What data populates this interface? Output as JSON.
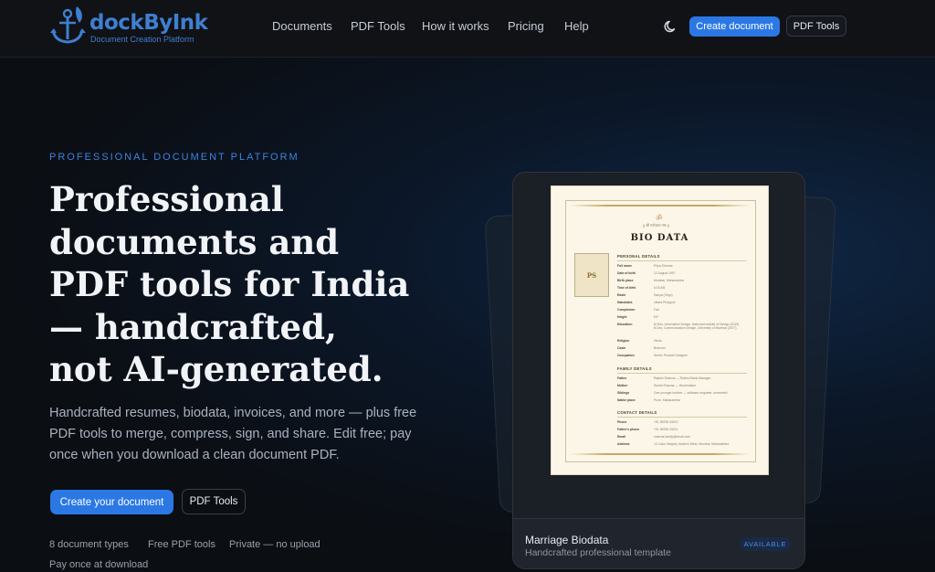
{
  "brand": {
    "name": "dockByInk",
    "tagline": "Document Creation Platform",
    "logo_icon": "anchor-icon",
    "color": "#3f7fd0"
  },
  "nav": {
    "links": [
      "Documents",
      "PDF Tools",
      "How it works",
      "Pricing",
      "Help"
    ],
    "theme_icon": "moon-icon",
    "create_label": "Create document",
    "pdf_tools_label": "PDF Tools"
  },
  "hero": {
    "eyebrow": "PROFESSIONAL DOCUMENT PLATFORM",
    "headline_lines": [
      "Professional",
      "documents and",
      "PDF tools for India",
      "— handcrafted,",
      "not AI-generated."
    ],
    "subcopy": "Handcrafted resumes, biodata, invoices, and more — plus free PDF tools to merge, compress, sign, and share. Edit free; pay once when you download a clean document PDF.",
    "cta_primary": "Create your document",
    "cta_secondary": "PDF Tools",
    "features": [
      "8 document types",
      "Free PDF tools",
      "Private — no upload",
      "Pay once at download"
    ]
  },
  "preview": {
    "document": {
      "invocation": "|| श्री गणेशाय नमः ||",
      "title": "BIO DATA",
      "photo_initials": "PS",
      "sections": {
        "personal": "PERSONAL DETAILS",
        "family": "FAMILY DETAILS",
        "contact": "CONTACT DETAILS"
      },
      "personal_rows": [
        {
          "k": "Full name",
          "v": "Priya Sharma"
        },
        {
          "k": "Date of birth",
          "v": "12 August 1997"
        },
        {
          "k": "Birth place",
          "v": "Mumbai, Maharashtra"
        },
        {
          "k": "Time of birth",
          "v": "6:15 AM"
        },
        {
          "k": "Rashi",
          "v": "Kanya (Virgo)"
        },
        {
          "k": "Nakshatra",
          "v": "Uttara Phalguni"
        },
        {
          "k": "Complexion",
          "v": "Fair"
        },
        {
          "k": "Height",
          "v": "5'4\""
        },
        {
          "k": "Education",
          "v": "M.Des, Information Design, National Institute of Design (2019) · B.Des, Communication Design, University of Mumbai (2017)"
        },
        {
          "k": "Religion",
          "v": "Hindu"
        },
        {
          "k": "Caste",
          "v": "Brahmin"
        },
        {
          "k": "Occupation",
          "v": "Senior Product Designer"
        }
      ],
      "family_rows": [
        {
          "k": "Father",
          "v": "Rajesh Sharma — Retired Bank Manager"
        },
        {
          "k": "Mother",
          "v": "Sunita Sharma — Homemaker"
        },
        {
          "k": "Siblings",
          "v": "One younger brother — software engineer, unmarried"
        },
        {
          "k": "Native place",
          "v": "Pune, Maharashtra"
        }
      ],
      "contact_rows": [
        {
          "k": "Phone",
          "v": "+91 98765 43210"
        },
        {
          "k": "Father's phone",
          "v": "+91 98765 43211"
        },
        {
          "k": "Email",
          "v": "sharma.family@email.com"
        },
        {
          "k": "Address",
          "v": "14 Lotus Heights, Andheri West, Mumbai, Maharashtra"
        }
      ],
      "accent": "#c9a862"
    },
    "card_title": "Marriage Biodata",
    "card_subtitle": "Handcrafted professional template",
    "badge": "AVAILABLE"
  },
  "colors": {
    "accent": "#2b78e4",
    "background": "#0b0e13"
  }
}
